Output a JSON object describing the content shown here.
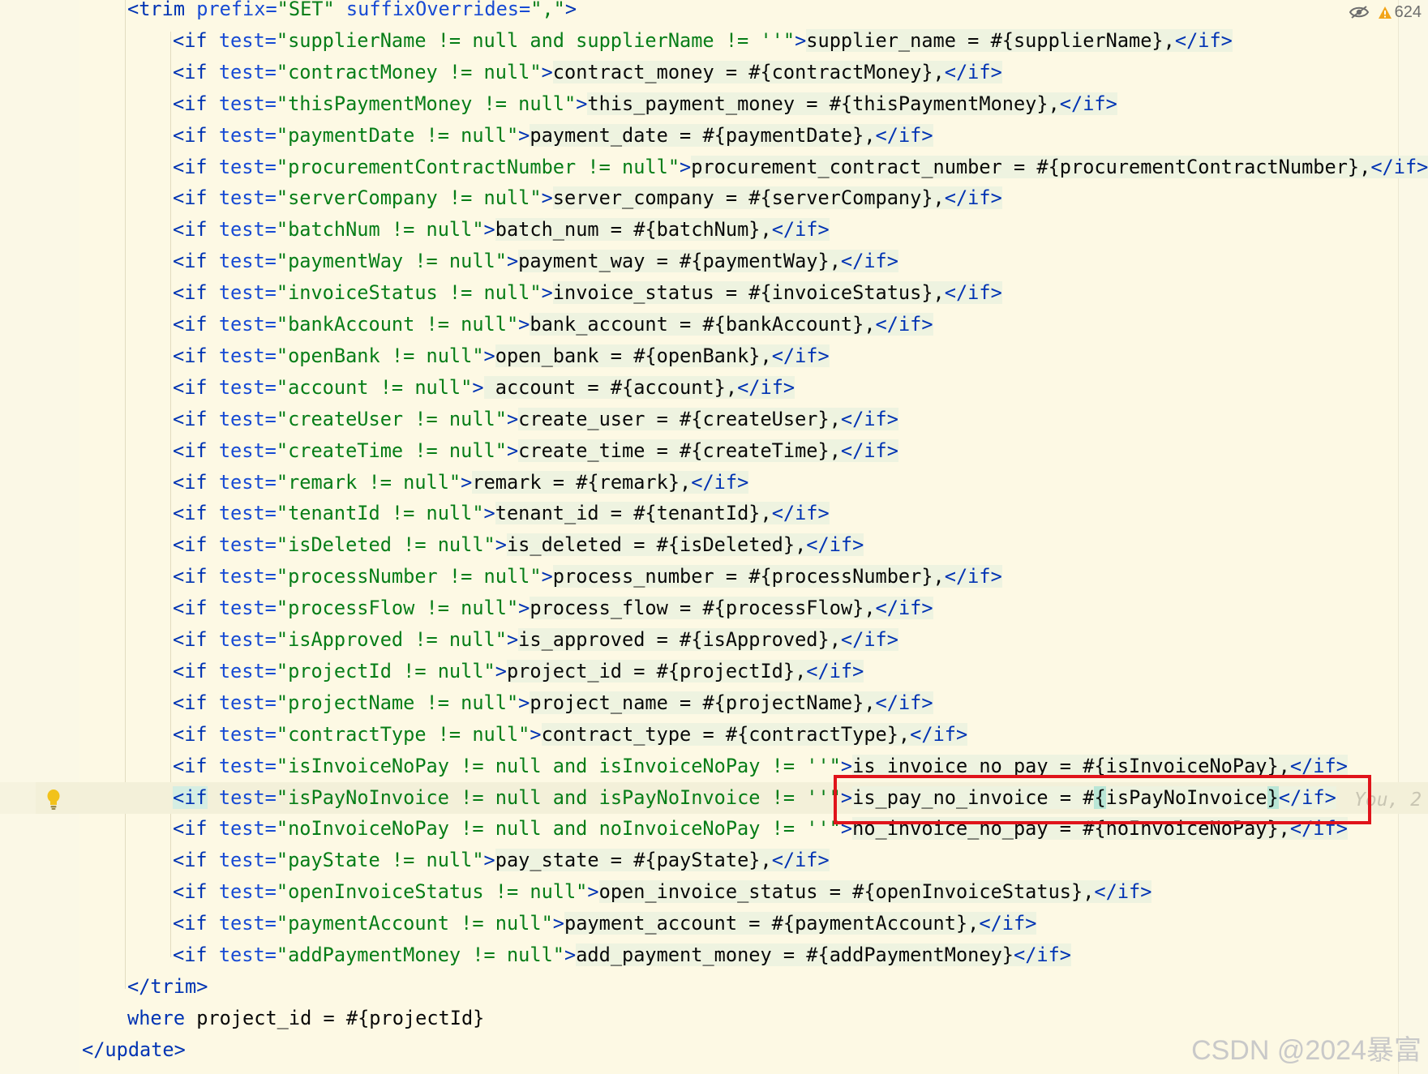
{
  "inspections": {
    "warning_count": "624"
  },
  "lines": [
    {
      "id": "trim-open",
      "indent": 0,
      "segments": [
        {
          "t": "<trim ",
          "c": "tag"
        },
        {
          "t": "prefix=",
          "c": "attr"
        },
        {
          "t": "\"SET\"",
          "c": "str"
        },
        {
          "t": " suffixOverrides=",
          "c": "attr"
        },
        {
          "t": "\",\"",
          "c": "str"
        },
        {
          "t": ">",
          "c": "tag"
        }
      ]
    },
    {
      "id": "if-supplier-name",
      "indent": 1,
      "segments": [
        {
          "t": "<if ",
          "c": "tag"
        },
        {
          "t": "test=",
          "c": "attr"
        },
        {
          "t": "\"supplierName != null and supplierName != ''\"",
          "c": "str"
        },
        {
          "t": ">",
          "c": "tag"
        },
        {
          "t": "supplier_name = #{supplierName},",
          "c": "txt ovl"
        },
        {
          "t": "</if>",
          "c": "tag ovl"
        }
      ]
    },
    {
      "id": "if-contract-money",
      "indent": 1,
      "segments": [
        {
          "t": "<if ",
          "c": "tag"
        },
        {
          "t": "test=",
          "c": "attr"
        },
        {
          "t": "\"contractMoney != null\"",
          "c": "str"
        },
        {
          "t": ">",
          "c": "tag"
        },
        {
          "t": "contract_money = #{contractMoney},",
          "c": "txt ovl"
        },
        {
          "t": "</if>",
          "c": "tag ovl"
        }
      ]
    },
    {
      "id": "if-this-payment-money",
      "indent": 1,
      "segments": [
        {
          "t": "<if ",
          "c": "tag"
        },
        {
          "t": "test=",
          "c": "attr"
        },
        {
          "t": "\"thisPaymentMoney != null\"",
          "c": "str"
        },
        {
          "t": ">",
          "c": "tag"
        },
        {
          "t": "this_payment_money = #{thisPaymentMoney},",
          "c": "txt ovl"
        },
        {
          "t": "</if>",
          "c": "tag ovl"
        }
      ]
    },
    {
      "id": "if-payment-date",
      "indent": 1,
      "segments": [
        {
          "t": "<if ",
          "c": "tag"
        },
        {
          "t": "test=",
          "c": "attr"
        },
        {
          "t": "\"paymentDate != null\"",
          "c": "str"
        },
        {
          "t": ">",
          "c": "tag"
        },
        {
          "t": "payment_date = #{paymentDate},",
          "c": "txt ovl"
        },
        {
          "t": "</if>",
          "c": "tag ovl"
        }
      ]
    },
    {
      "id": "if-procurement-contract-number",
      "indent": 1,
      "segments": [
        {
          "t": "<if ",
          "c": "tag"
        },
        {
          "t": "test=",
          "c": "attr"
        },
        {
          "t": "\"procurementContractNumber != null\"",
          "c": "str"
        },
        {
          "t": ">",
          "c": "tag"
        },
        {
          "t": "procurement_contract_number = #{procurementContractNumber},",
          "c": "txt ovl"
        },
        {
          "t": "</if>",
          "c": "tag ovl"
        }
      ]
    },
    {
      "id": "if-server-company",
      "indent": 1,
      "segments": [
        {
          "t": "<if ",
          "c": "tag"
        },
        {
          "t": "test=",
          "c": "attr"
        },
        {
          "t": "\"serverCompany != null\"",
          "c": "str"
        },
        {
          "t": ">",
          "c": "tag"
        },
        {
          "t": "server_company = #{serverCompany},",
          "c": "txt ovl"
        },
        {
          "t": "</if>",
          "c": "tag ovl"
        }
      ]
    },
    {
      "id": "if-batch-num",
      "indent": 1,
      "segments": [
        {
          "t": "<if ",
          "c": "tag"
        },
        {
          "t": "test=",
          "c": "attr"
        },
        {
          "t": "\"batchNum != null\"",
          "c": "str"
        },
        {
          "t": ">",
          "c": "tag"
        },
        {
          "t": "batch_num = #{batchNum},",
          "c": "txt ovl"
        },
        {
          "t": "</if>",
          "c": "tag ovl"
        }
      ]
    },
    {
      "id": "if-payment-way",
      "indent": 1,
      "segments": [
        {
          "t": "<if ",
          "c": "tag"
        },
        {
          "t": "test=",
          "c": "attr"
        },
        {
          "t": "\"paymentWay != null\"",
          "c": "str"
        },
        {
          "t": ">",
          "c": "tag"
        },
        {
          "t": "payment_way = #{paymentWay},",
          "c": "txt ovl"
        },
        {
          "t": "</if>",
          "c": "tag ovl"
        }
      ]
    },
    {
      "id": "if-invoice-status",
      "indent": 1,
      "segments": [
        {
          "t": "<if ",
          "c": "tag"
        },
        {
          "t": "test=",
          "c": "attr"
        },
        {
          "t": "\"invoiceStatus != null\"",
          "c": "str"
        },
        {
          "t": ">",
          "c": "tag"
        },
        {
          "t": "invoice_status = #{invoiceStatus},",
          "c": "txt ovl"
        },
        {
          "t": "</if>",
          "c": "tag ovl"
        }
      ]
    },
    {
      "id": "if-bank-account",
      "indent": 1,
      "segments": [
        {
          "t": "<if ",
          "c": "tag"
        },
        {
          "t": "test=",
          "c": "attr"
        },
        {
          "t": "\"bankAccount != null\"",
          "c": "str"
        },
        {
          "t": ">",
          "c": "tag"
        },
        {
          "t": "bank_account = #{bankAccount},",
          "c": "txt ovl"
        },
        {
          "t": "</if>",
          "c": "tag ovl"
        }
      ]
    },
    {
      "id": "if-open-bank",
      "indent": 1,
      "segments": [
        {
          "t": "<if ",
          "c": "tag"
        },
        {
          "t": "test=",
          "c": "attr"
        },
        {
          "t": "\"openBank != null\"",
          "c": "str"
        },
        {
          "t": ">",
          "c": "tag"
        },
        {
          "t": "open_bank = #{openBank},",
          "c": "txt ovl"
        },
        {
          "t": "</if>",
          "c": "tag ovl"
        }
      ]
    },
    {
      "id": "if-account",
      "indent": 1,
      "segments": [
        {
          "t": "<if ",
          "c": "tag"
        },
        {
          "t": "test=",
          "c": "attr"
        },
        {
          "t": "\"account != null\"",
          "c": "str"
        },
        {
          "t": ">",
          "c": "tag"
        },
        {
          "t": " account = #{account},",
          "c": "txt ovl"
        },
        {
          "t": "</if>",
          "c": "tag ovl"
        }
      ]
    },
    {
      "id": "if-create-user",
      "indent": 1,
      "segments": [
        {
          "t": "<if ",
          "c": "tag"
        },
        {
          "t": "test=",
          "c": "attr"
        },
        {
          "t": "\"createUser != null\"",
          "c": "str"
        },
        {
          "t": ">",
          "c": "tag"
        },
        {
          "t": "create_user = #{createUser},",
          "c": "txt ovl"
        },
        {
          "t": "</if>",
          "c": "tag ovl"
        }
      ]
    },
    {
      "id": "if-create-time",
      "indent": 1,
      "segments": [
        {
          "t": "<if ",
          "c": "tag"
        },
        {
          "t": "test=",
          "c": "attr"
        },
        {
          "t": "\"createTime != null\"",
          "c": "str"
        },
        {
          "t": ">",
          "c": "tag"
        },
        {
          "t": "create_time = #{createTime},",
          "c": "txt ovl"
        },
        {
          "t": "</if>",
          "c": "tag ovl"
        }
      ]
    },
    {
      "id": "if-remark",
      "indent": 1,
      "segments": [
        {
          "t": "<if ",
          "c": "tag"
        },
        {
          "t": "test=",
          "c": "attr"
        },
        {
          "t": "\"remark != null\"",
          "c": "str"
        },
        {
          "t": ">",
          "c": "tag"
        },
        {
          "t": "remark = #{remark},",
          "c": "txt ovl"
        },
        {
          "t": "</if>",
          "c": "tag ovl"
        }
      ]
    },
    {
      "id": "if-tenant-id",
      "indent": 1,
      "segments": [
        {
          "t": "<if ",
          "c": "tag"
        },
        {
          "t": "test=",
          "c": "attr"
        },
        {
          "t": "\"tenantId != null\"",
          "c": "str"
        },
        {
          "t": ">",
          "c": "tag"
        },
        {
          "t": "tenant_id = #{tenantId},",
          "c": "txt ovl"
        },
        {
          "t": "</if>",
          "c": "tag ovl"
        }
      ]
    },
    {
      "id": "if-is-deleted",
      "indent": 1,
      "segments": [
        {
          "t": "<if ",
          "c": "tag"
        },
        {
          "t": "test=",
          "c": "attr"
        },
        {
          "t": "\"isDeleted != null\"",
          "c": "str"
        },
        {
          "t": ">",
          "c": "tag"
        },
        {
          "t": "is_deleted = #{isDeleted},",
          "c": "txt ovl"
        },
        {
          "t": "</if>",
          "c": "tag ovl"
        }
      ]
    },
    {
      "id": "if-process-number",
      "indent": 1,
      "segments": [
        {
          "t": "<if ",
          "c": "tag"
        },
        {
          "t": "test=",
          "c": "attr"
        },
        {
          "t": "\"processNumber != null\"",
          "c": "str"
        },
        {
          "t": ">",
          "c": "tag"
        },
        {
          "t": "process_number = #{processNumber},",
          "c": "txt ovl"
        },
        {
          "t": "</if>",
          "c": "tag ovl"
        }
      ]
    },
    {
      "id": "if-process-flow",
      "indent": 1,
      "segments": [
        {
          "t": "<if ",
          "c": "tag"
        },
        {
          "t": "test=",
          "c": "attr"
        },
        {
          "t": "\"processFlow != null\"",
          "c": "str"
        },
        {
          "t": ">",
          "c": "tag"
        },
        {
          "t": "process_flow = #{processFlow},",
          "c": "txt ovl"
        },
        {
          "t": "</if>",
          "c": "tag ovl"
        }
      ]
    },
    {
      "id": "if-is-approved",
      "indent": 1,
      "segments": [
        {
          "t": "<if ",
          "c": "tag"
        },
        {
          "t": "test=",
          "c": "attr"
        },
        {
          "t": "\"isApproved != null\"",
          "c": "str"
        },
        {
          "t": ">",
          "c": "tag"
        },
        {
          "t": "is_approved = #{isApproved},",
          "c": "txt ovl"
        },
        {
          "t": "</if>",
          "c": "tag ovl"
        }
      ]
    },
    {
      "id": "if-project-id",
      "indent": 1,
      "segments": [
        {
          "t": "<if ",
          "c": "tag"
        },
        {
          "t": "test=",
          "c": "attr"
        },
        {
          "t": "\"projectId != null\"",
          "c": "str"
        },
        {
          "t": ">",
          "c": "tag"
        },
        {
          "t": "project_id = #{projectId},",
          "c": "txt ovl"
        },
        {
          "t": "</if>",
          "c": "tag ovl"
        }
      ]
    },
    {
      "id": "if-project-name",
      "indent": 1,
      "segments": [
        {
          "t": "<if ",
          "c": "tag"
        },
        {
          "t": "test=",
          "c": "attr"
        },
        {
          "t": "\"projectName != null\"",
          "c": "str"
        },
        {
          "t": ">",
          "c": "tag"
        },
        {
          "t": "project_name = #{projectName},",
          "c": "txt ovl"
        },
        {
          "t": "</if>",
          "c": "tag ovl"
        }
      ]
    },
    {
      "id": "if-contract-type",
      "indent": 1,
      "segments": [
        {
          "t": "<if ",
          "c": "tag"
        },
        {
          "t": "test=",
          "c": "attr"
        },
        {
          "t": "\"contractType != null\"",
          "c": "str"
        },
        {
          "t": ">",
          "c": "tag"
        },
        {
          "t": "contract_type = #{contractType},",
          "c": "txt ovl"
        },
        {
          "t": "</if>",
          "c": "tag ovl"
        }
      ]
    },
    {
      "id": "if-is-invoice-no-pay",
      "indent": 1,
      "segments": [
        {
          "t": "<if ",
          "c": "tag"
        },
        {
          "t": "test=",
          "c": "attr"
        },
        {
          "t": "\"isInvoiceNoPay != null and isInvoiceNoPay != ''\"",
          "c": "str"
        },
        {
          "t": ">",
          "c": "tag"
        },
        {
          "t": "is_invoice_no_pay = #{isInvoiceNoPay},",
          "c": "txt ovl"
        },
        {
          "t": "</if>",
          "c": "tag ovl"
        }
      ]
    },
    {
      "id": "if-is-pay-no-invoice",
      "indent": 1,
      "caret": true,
      "segments": [
        {
          "t": "<",
          "c": "tag hlt"
        },
        {
          "t": "if",
          "c": "tag hlt"
        },
        {
          "t": " ",
          "c": "txt"
        },
        {
          "t": "test=",
          "c": "attr"
        },
        {
          "t": "\"isPayNoInvoice != null and isPayNoInvoice != ''\"",
          "c": "str"
        },
        {
          "t": ">",
          "c": "tag"
        },
        {
          "t": "is_pay_no_invoice = ",
          "c": "txt ovl"
        },
        {
          "t": "#",
          "c": "txt ovl"
        },
        {
          "t": "{",
          "c": "txt hl"
        },
        {
          "t": "isPayNoInvoice",
          "c": "txt ovl"
        },
        {
          "t": "}",
          "c": "txt hl"
        },
        {
          "t": "</if>",
          "c": "tag ovl"
        }
      ]
    },
    {
      "id": "if-no-invoice-no-pay",
      "indent": 1,
      "segments": [
        {
          "t": "<if ",
          "c": "tag"
        },
        {
          "t": "test=",
          "c": "attr"
        },
        {
          "t": "\"noInvoiceNoPay != null and noInvoiceNoPay != ''\"",
          "c": "str"
        },
        {
          "t": ">",
          "c": "tag"
        },
        {
          "t": "no_invoice_no_pay = #{noInvoiceNoPay},",
          "c": "txt ovl"
        },
        {
          "t": "</if>",
          "c": "tag ovl"
        }
      ]
    },
    {
      "id": "if-pay-state",
      "indent": 1,
      "segments": [
        {
          "t": "<if ",
          "c": "tag"
        },
        {
          "t": "test=",
          "c": "attr"
        },
        {
          "t": "\"payState != null\"",
          "c": "str"
        },
        {
          "t": ">",
          "c": "tag"
        },
        {
          "t": "pay_state = #{payState},",
          "c": "txt ovl"
        },
        {
          "t": "</if>",
          "c": "tag ovl"
        }
      ]
    },
    {
      "id": "if-open-invoice-status",
      "indent": 1,
      "segments": [
        {
          "t": "<if ",
          "c": "tag"
        },
        {
          "t": "test=",
          "c": "attr"
        },
        {
          "t": "\"openInvoiceStatus != null\"",
          "c": "str"
        },
        {
          "t": ">",
          "c": "tag"
        },
        {
          "t": "open_invoice_status = #{openInvoiceStatus},",
          "c": "txt ovl"
        },
        {
          "t": "</if>",
          "c": "tag ovl"
        }
      ]
    },
    {
      "id": "if-payment-account",
      "indent": 1,
      "segments": [
        {
          "t": "<if ",
          "c": "tag"
        },
        {
          "t": "test=",
          "c": "attr"
        },
        {
          "t": "\"paymentAccount != null\"",
          "c": "str"
        },
        {
          "t": ">",
          "c": "tag"
        },
        {
          "t": "payment_account = #{paymentAccount},",
          "c": "txt ovl"
        },
        {
          "t": "</if>",
          "c": "tag ovl"
        }
      ]
    },
    {
      "id": "if-add-payment-money",
      "indent": 1,
      "segments": [
        {
          "t": "<if ",
          "c": "tag"
        },
        {
          "t": "test=",
          "c": "attr"
        },
        {
          "t": "\"addPaymentMoney != null\"",
          "c": "str"
        },
        {
          "t": ">",
          "c": "tag"
        },
        {
          "t": "add_payment_money = #{addPaymentMoney}",
          "c": "txt ovl"
        },
        {
          "t": "</if>",
          "c": "tag ovl"
        }
      ]
    },
    {
      "id": "trim-close",
      "indent": 0,
      "segments": [
        {
          "t": "</trim>",
          "c": "tag"
        }
      ]
    },
    {
      "id": "where-clause",
      "indent": 0,
      "segments": [
        {
          "t": "where",
          "c": "tag"
        },
        {
          "t": " project_id = #{projectId}",
          "c": "txt"
        }
      ]
    },
    {
      "id": "update-close",
      "indent": -1,
      "segments": [
        {
          "t": "</update>",
          "c": "tag"
        }
      ]
    }
  ],
  "inline_hint": "You, 2",
  "watermark": "CSDN @2024暴富"
}
